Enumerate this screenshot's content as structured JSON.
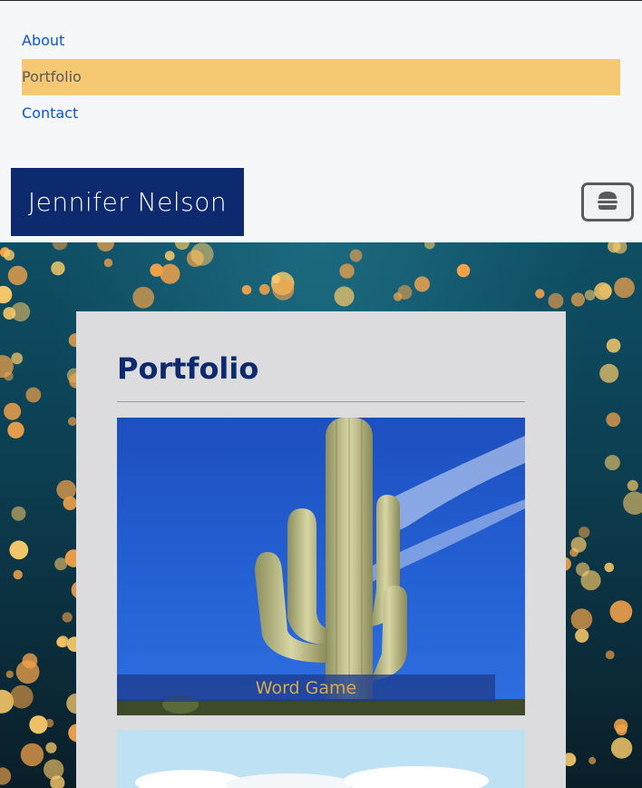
{
  "nav": {
    "items": [
      {
        "label": "About",
        "active": false
      },
      {
        "label": "Portfolio",
        "active": true
      },
      {
        "label": "Contact",
        "active": false
      }
    ]
  },
  "brand": {
    "name": "Jennifer Nelson"
  },
  "menu_button": {
    "icon": "hamburger-icon"
  },
  "portfolio": {
    "title": "Portfolio",
    "items": [
      {
        "caption": "Word Game"
      }
    ]
  },
  "colors": {
    "brand_bg": "#0d2a6e",
    "nav_active": "#f5c873",
    "link": "#0b57d0",
    "caption_text": "#d9a94a"
  }
}
